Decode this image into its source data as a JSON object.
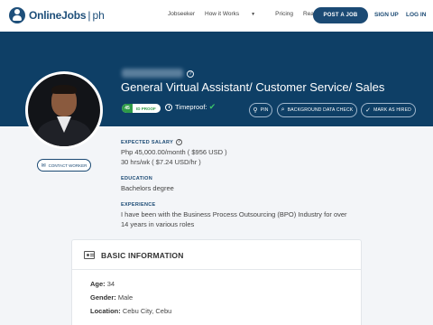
{
  "brand": {
    "name": "OnlineJobs",
    "sep": "|",
    "suffix": "ph"
  },
  "nav": {
    "links": [
      "Jobseeker",
      "How it Works",
      "Pricing",
      "Real Results"
    ],
    "post_job": "POST A JOB",
    "signup": "SIGN UP",
    "login": "LOG IN"
  },
  "profile": {
    "title": "General Virtual Assistant/ Customer Service/ Sales",
    "id_proof_num": "45",
    "id_proof_label": "ID PROOF",
    "timeproof": "Timeproof:",
    "actions": {
      "pin": "PIN",
      "background": "BACKGROUND DATA CHECK",
      "hire": "MARK AS HIRED"
    },
    "contact": "CONTACT WORKER"
  },
  "salary": {
    "heading": "EXPECTED SALARY",
    "monthly": "Php 45,000.00/month ( $956 USD )",
    "hourly": "30 hrs/wk ( $7.24 USD/hr )"
  },
  "education": {
    "heading": "EDUCATION",
    "value": "Bachelors degree"
  },
  "experience": {
    "heading": "EXPERIENCE",
    "line1": "I have been with the Business Process Outsourcing (BPO) Industry for over",
    "line2": "14 years in various roles"
  },
  "basic_info": {
    "title": "BASIC INFORMATION",
    "age_label": "Age:",
    "age": "34",
    "gender_label": "Gender:",
    "gender": "Male",
    "location_label": "Location:",
    "location": "Cebu City, Cebu"
  },
  "colors": {
    "nav_bg": "#ffffff",
    "hero_bg": "#0e3f66",
    "accent": "#1b4a74",
    "badge_green": "#2e9b48"
  },
  "icons": [
    "logo-icon",
    "question-icon",
    "clock-icon",
    "check-icon",
    "pin-icon",
    "search-icon",
    "check-circle-icon",
    "mail-icon",
    "id-card-icon"
  ]
}
